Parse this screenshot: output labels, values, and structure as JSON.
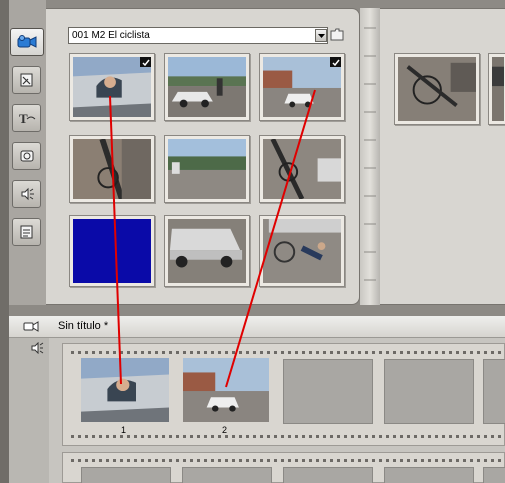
{
  "album": {
    "scene_select": {
      "value": "001 M2 El ciclista"
    },
    "tabs": [
      {
        "icon": "video-camera-icon",
        "active": true
      },
      {
        "icon": "transition-icon",
        "active": false
      },
      {
        "icon": "title-icon",
        "active": false
      },
      {
        "icon": "still-image-icon",
        "active": false
      },
      {
        "icon": "sound-effect-icon",
        "active": false
      },
      {
        "icon": "menu-icon",
        "active": false
      }
    ],
    "thumbs": [
      {
        "scene": "man-in-car",
        "checked": true
      },
      {
        "scene": "street-with-cars",
        "checked": false
      },
      {
        "scene": "white-car-road",
        "checked": true
      },
      {
        "scene": "bicycle-road",
        "checked": false
      },
      {
        "scene": "road-landscape",
        "checked": false
      },
      {
        "scene": "bicycle-side",
        "checked": false
      },
      {
        "scene": "blue-frame",
        "checked": false
      },
      {
        "scene": "car-bumper",
        "checked": false
      },
      {
        "scene": "crashed-cyclist",
        "checked": false
      }
    ]
  },
  "movie": {
    "title": "Sin título *",
    "clips": [
      {
        "number": "1",
        "scene": "man-in-car"
      },
      {
        "number": "2",
        "scene": "white-car-road"
      }
    ]
  },
  "colors": {
    "link_line": "#e00000",
    "blue_frame": "#0a0aa8"
  }
}
